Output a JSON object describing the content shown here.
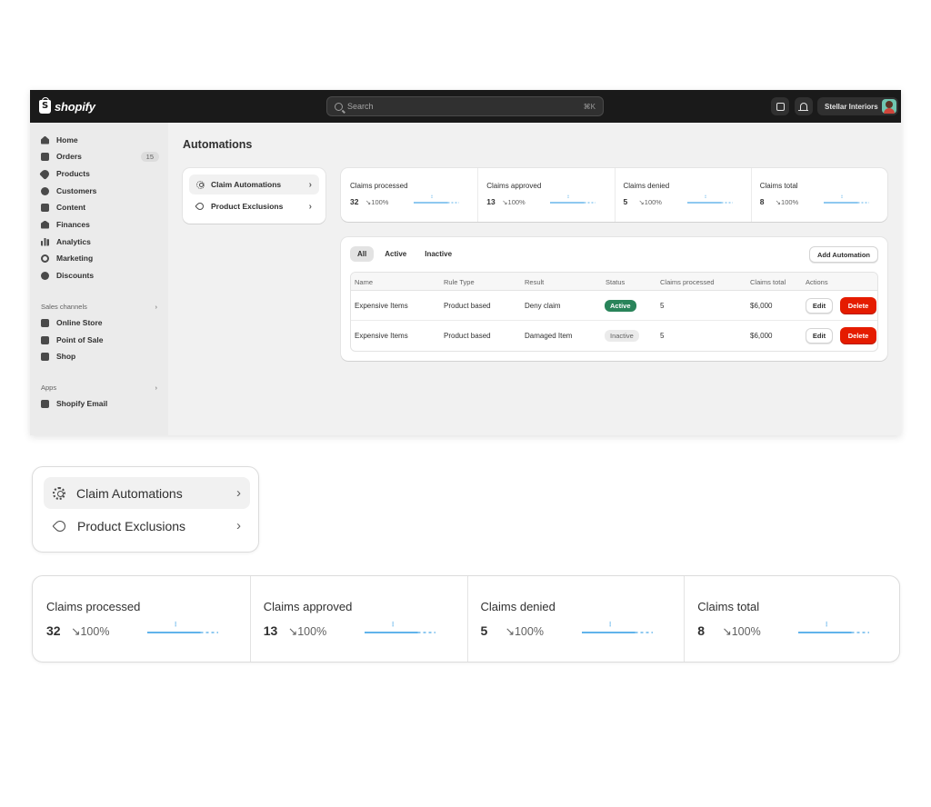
{
  "topbar": {
    "brand": "shopify",
    "search_placeholder": "Search",
    "search_shortcut": "⌘K",
    "store_name": "Stellar Interiors"
  },
  "sidebar": {
    "items": [
      {
        "label": "Home",
        "icon": "home-icon"
      },
      {
        "label": "Orders",
        "icon": "orders-icon",
        "badge": "15"
      },
      {
        "label": "Products",
        "icon": "tag-icon"
      },
      {
        "label": "Customers",
        "icon": "person-icon"
      },
      {
        "label": "Content",
        "icon": "content-icon"
      },
      {
        "label": "Finances",
        "icon": "bank-icon"
      },
      {
        "label": "Analytics",
        "icon": "bar-chart-icon"
      },
      {
        "label": "Marketing",
        "icon": "target-icon"
      },
      {
        "label": "Discounts",
        "icon": "discount-icon"
      }
    ],
    "sales_channels_label": "Sales channels",
    "sales_channels": [
      {
        "label": "Online Store",
        "icon": "store-icon"
      },
      {
        "label": "Point of Sale",
        "icon": "pos-icon"
      },
      {
        "label": "Shop",
        "icon": "shop-icon"
      }
    ],
    "apps_label": "Apps",
    "apps": [
      {
        "label": "Shopify Email",
        "icon": "email-icon"
      }
    ]
  },
  "main": {
    "title": "Automations",
    "menu": [
      {
        "label": "Claim Automations",
        "icon": "gear-icon",
        "active": true
      },
      {
        "label": "Product Exclusions",
        "icon": "tag-icon",
        "active": false
      }
    ],
    "stats": [
      {
        "label": "Claims processed",
        "value": "32",
        "change": "↘100%"
      },
      {
        "label": "Claims approved",
        "value": "13",
        "change": "↘100%"
      },
      {
        "label": "Claims denied",
        "value": "5",
        "change": "↘100%"
      },
      {
        "label": "Claims total",
        "value": "8",
        "change": "↘100%"
      }
    ],
    "tabs": [
      "All",
      "Active",
      "Inactive"
    ],
    "add_button": "Add Automation",
    "table": {
      "headers": [
        "Name",
        "Rule Type",
        "Result",
        "Status",
        "Claims processed",
        "Claims total",
        "Actions"
      ],
      "rows": [
        {
          "name": "Expensive Items",
          "rule_type": "Product based",
          "result": "Deny claim",
          "status": "Active",
          "claims_processed": "5",
          "claims_total": "$6,000",
          "edit": "Edit",
          "delete": "Delete"
        },
        {
          "name": "Expensive Items",
          "rule_type": "Product based",
          "result": "Damaged Item",
          "status": "Inactive",
          "claims_processed": "5",
          "claims_total": "$6,000",
          "edit": "Edit",
          "delete": "Delete"
        }
      ]
    }
  },
  "colors": {
    "topbar": "#1a1a1a",
    "active_badge": "#29845a",
    "delete_button": "#e51c00",
    "sparkline": "#4aa8e8"
  }
}
